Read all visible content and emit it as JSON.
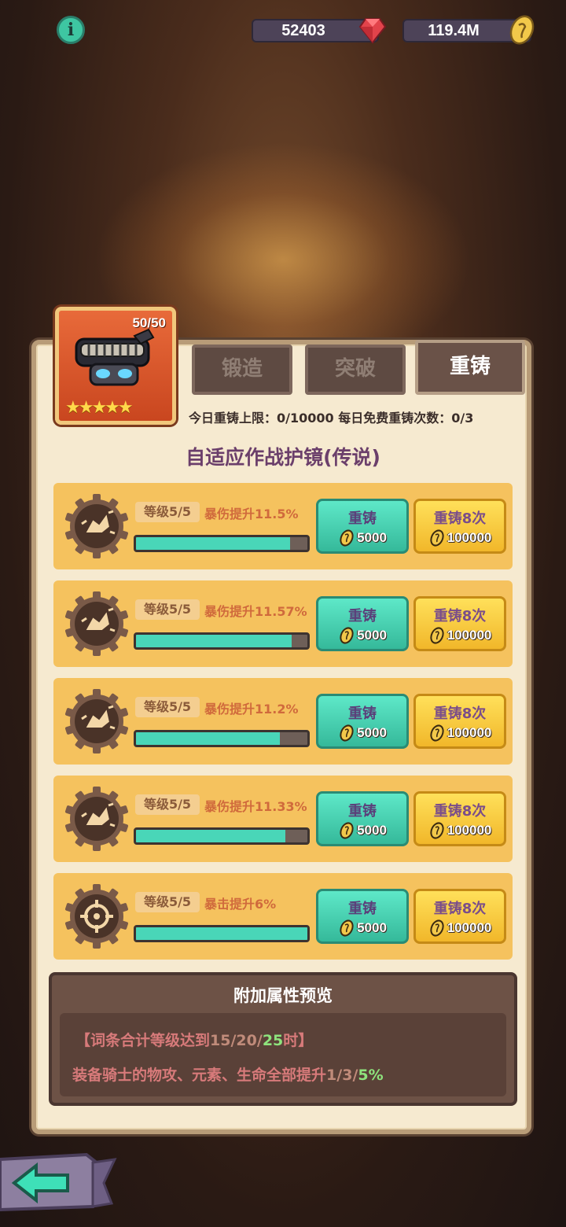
{
  "topbar": {
    "info_icon": "info-icon",
    "gems": "52403",
    "gold": "119.4M"
  },
  "equipment": {
    "count": "50/50",
    "stars": "★★★★★",
    "name": "自适应作战护镜(传说)"
  },
  "tabs": [
    {
      "label": "锻造",
      "active": false
    },
    {
      "label": "突破",
      "active": false
    },
    {
      "label": "重铸",
      "active": true
    }
  ],
  "limits_text": "今日重铸上限：0/10000  每日免费重铸次数：0/3",
  "rows": [
    {
      "level": "等级5/5",
      "stat": "暴伤提升11.5%",
      "progress": 0.9,
      "btn1_label": "重铸",
      "btn1_cost": "5000",
      "btn2_label": "重铸8次",
      "btn2_cost": "100000",
      "icon": "crit-damage-icon"
    },
    {
      "level": "等级5/5",
      "stat": "暴伤提升11.57%",
      "progress": 0.91,
      "btn1_label": "重铸",
      "btn1_cost": "5000",
      "btn2_label": "重铸8次",
      "btn2_cost": "100000",
      "icon": "crit-damage-icon"
    },
    {
      "level": "等级5/5",
      "stat": "暴伤提升11.2%",
      "progress": 0.84,
      "btn1_label": "重铸",
      "btn1_cost": "5000",
      "btn2_label": "重铸8次",
      "btn2_cost": "100000",
      "icon": "crit-damage-icon"
    },
    {
      "level": "等级5/5",
      "stat": "暴伤提升11.33%",
      "progress": 0.87,
      "btn1_label": "重铸",
      "btn1_cost": "5000",
      "btn2_label": "重铸8次",
      "btn2_cost": "100000",
      "icon": "crit-damage-icon"
    },
    {
      "level": "等级5/5",
      "stat": "暴击提升6%",
      "progress": 1.0,
      "btn1_label": "重铸",
      "btn1_cost": "5000",
      "btn2_label": "重铸8次",
      "btn2_cost": "100000",
      "icon": "crit-rate-icon"
    }
  ],
  "preview": {
    "title": "附加属性预览",
    "line1_prefix": "【词条合计等级达到",
    "line1_t1": "15",
    "line1_sep1": "/",
    "line1_t2": "20",
    "line1_sep2": "/",
    "line1_t3": "25",
    "line1_suffix": "时】",
    "line2_prefix": "装备骑士的物攻、元素、生命全部提升",
    "line2_v1": "1",
    "line2_sep1": "/",
    "line2_v2": "3",
    "line2_sep2": "/",
    "line2_v3": "5%"
  },
  "back_icon": "back-arrow-icon"
}
